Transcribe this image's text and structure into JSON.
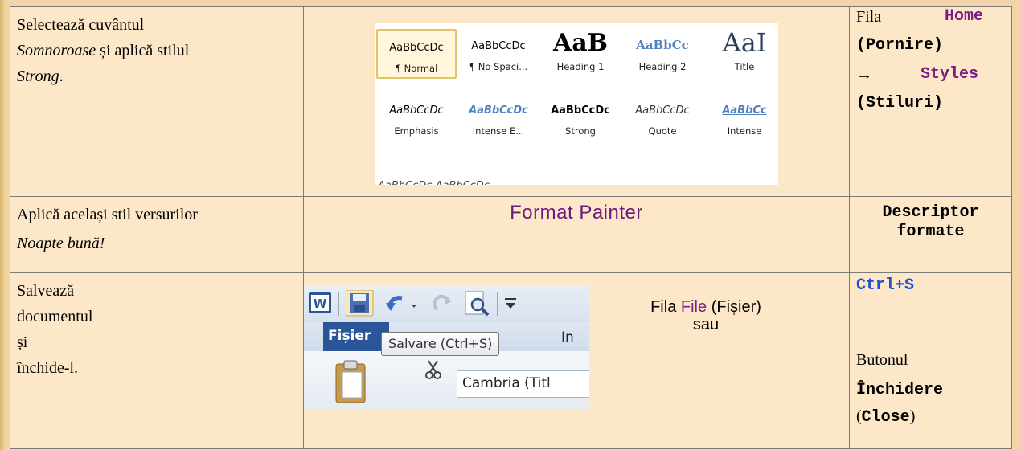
{
  "rows": [
    {
      "task": {
        "line1": "Selectează cuvântul",
        "word": "Somnoroase",
        "line2_rest": " și aplică stilul",
        "style_word": "Strong",
        "style_end": "."
      },
      "styles_gallery": [
        {
          "sample": "AaBbCcDc",
          "name": "¶ Normal",
          "selected": true
        },
        {
          "sample": "AaBbCcDc",
          "name": "¶ No Spaci..."
        },
        {
          "sample": "AaB",
          "name": "Heading 1"
        },
        {
          "sample": "AaBbCc",
          "name": "Heading 2"
        },
        {
          "sample": "AaI",
          "name": "Title"
        },
        {
          "sample": "AaBbCcDc",
          "name": "Emphasis"
        },
        {
          "sample": "AaBbCcDc",
          "name": "Intense E..."
        },
        {
          "sample": "AaBbCcDc",
          "name": "Strong"
        },
        {
          "sample": "AaBbCcDc",
          "name": "Quote"
        },
        {
          "sample": "AaBbCc",
          "name": "Intense"
        }
      ],
      "gallery_cut_row": "AaBbCcDc  AaBbCcDc",
      "location": {
        "fila": "Fila",
        "home": "Home",
        "pornire": "(Pornire)",
        "arrow": "→",
        "styles": "Styles",
        "stiluri": "(Stiluri)"
      }
    },
    {
      "task": {
        "line1": "Aplică același stil versurilor",
        "verse": "Noapte bună!"
      },
      "tool": "Format Painter",
      "location": {
        "line1": "Descriptor",
        "line2": "formate"
      }
    },
    {
      "task": {
        "line1": "Salvează",
        "line2": "documentul",
        "line3": "și",
        "line4": "închide-l."
      },
      "ribbon": {
        "tab_file": "Fișier",
        "tooltip": "Salvare (Ctrl+S)",
        "tab_next": "In",
        "font_box": "Cambria (Titl"
      },
      "file_text": {
        "fila": "Fila",
        "file": "File",
        "fisier": "(Fișier)",
        "sau": "sau"
      },
      "location": {
        "shortcut": "Ctrl+S",
        "butonul": "Butonul",
        "inchidere": "Închidere",
        "close_open": "(",
        "close": "Close",
        "close_close": ")"
      }
    }
  ],
  "colors": {
    "page_bg": "#f3d3a8",
    "cell_bg": "#fde7c9",
    "purple": "#7b1f84",
    "blue": "#1f4fd6",
    "word_blue": "#2a5699"
  }
}
